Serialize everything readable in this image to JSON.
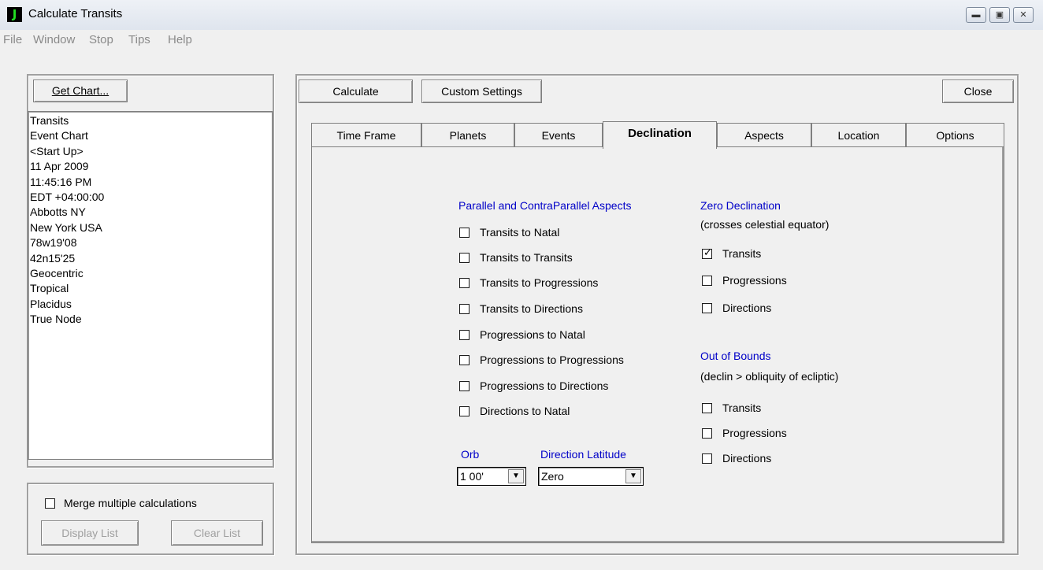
{
  "window": {
    "title": "Calculate Transits",
    "app_icon_letter": "J",
    "controls": [
      "minimize-icon",
      "maximize-icon",
      "close-icon"
    ]
  },
  "menu": [
    "File",
    "Window",
    "Stop",
    "Tips",
    "Help"
  ],
  "left_panel": {
    "get_chart_label": "Get Chart...",
    "chart_info": [
      "Transits",
      "Event Chart",
      "<Start Up>",
      "11 Apr 2009",
      "11:45:16 PM",
      "EDT +04:00:00",
      "Abbotts NY",
      "New York USA",
      "78w19'08",
      "42n15'25",
      "Geocentric",
      "Tropical",
      "Placidus",
      "True Node"
    ],
    "merge_label": "Merge multiple calculations",
    "merge_checked": false,
    "display_list_label": "Display List",
    "clear_list_label": "Clear List"
  },
  "toolbar": {
    "calculate_label": "Calculate",
    "custom_settings_label": "Custom Settings",
    "close_label": "Close"
  },
  "tabs": [
    "Time Frame",
    "Planets",
    "Events",
    "Declination",
    "Aspects",
    "Location",
    "Options"
  ],
  "active_tab": "Declination",
  "declination": {
    "parallel_heading": "Parallel and ContraParallel Aspects",
    "parallel_items": [
      {
        "label": "Transits to Natal",
        "checked": false
      },
      {
        "label": "Transits to Transits",
        "checked": false
      },
      {
        "label": "Transits to Progressions",
        "checked": false
      },
      {
        "label": "Transits to Directions",
        "checked": false
      },
      {
        "label": "Progressions to Natal",
        "checked": false
      },
      {
        "label": "Progressions to Progressions",
        "checked": false
      },
      {
        "label": "Progressions to Directions",
        "checked": false
      },
      {
        "label": "Directions to Natal",
        "checked": false
      }
    ],
    "orb_label": "Orb",
    "orb_value": "1 00'",
    "direction_latitude_label": "Direction Latitude",
    "direction_latitude_value": "Zero",
    "zero_heading": "Zero Declination",
    "zero_sub": "(crosses celestial equator)",
    "zero_items": [
      {
        "label": "Transits",
        "checked": true
      },
      {
        "label": "Progressions",
        "checked": false
      },
      {
        "label": "Directions",
        "checked": false
      }
    ],
    "oob_heading": "Out of Bounds",
    "oob_sub": "(declin > obliquity of ecliptic)",
    "oob_items": [
      {
        "label": "Transits",
        "checked": false
      },
      {
        "label": "Progressions",
        "checked": false
      },
      {
        "label": "Directions",
        "checked": false
      }
    ]
  },
  "colors": {
    "heading_blue": "#0000c8",
    "app_icon_green": "#22e022"
  }
}
